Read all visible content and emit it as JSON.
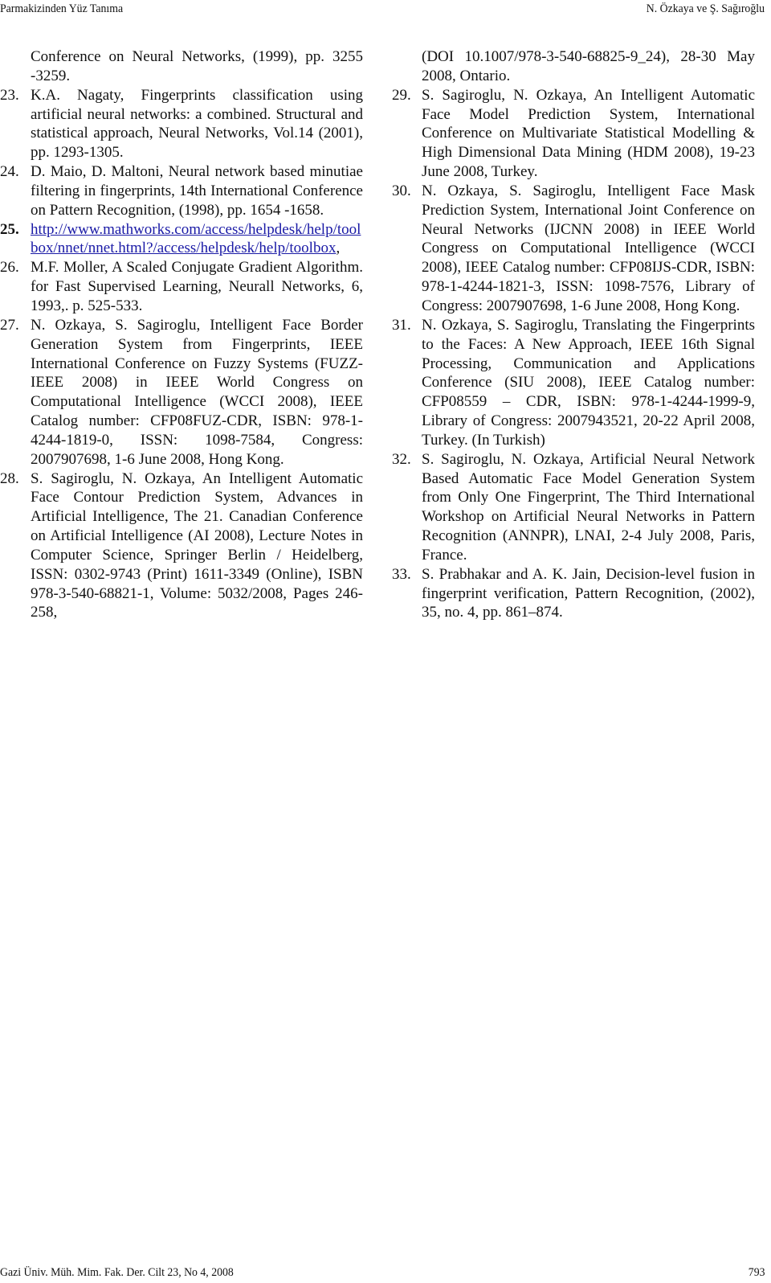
{
  "header": {
    "left": "Parmakizinden Yüz Tanıma",
    "right": "N. Özkaya ve Ş. Sağıroğlu"
  },
  "left_column": {
    "continuation": "Conference on Neural Networks, (1999), pp. 3255 -3259.",
    "refs": [
      {
        "num": "23.",
        "text": "K.A. Nagaty, Fingerprints classification using artificial neural networks: a combined. Structural and statistical approach, Neural Networks, Vol.14 (2001), pp. 1293-1305."
      },
      {
        "num": "24.",
        "text": "D. Maio, D. Maltoni, Neural network based minutiae filtering in fingerprints, 14th International Conference on Pattern Recognition, (1998), pp. 1654 -1658."
      },
      {
        "num": "25.",
        "link": "http://www.mathworks.com/access/helpdesk/help/toolbox/nnet/nnet.html?/access/helpdesk/help/toolbox",
        "after_link": ","
      },
      {
        "num": "26.",
        "text": "M.F. Moller, A Scaled Conjugate Gradient Algorithm. for Fast Supervised Learning, Neurall Networks, 6, 1993,. p. 525-533."
      },
      {
        "num": "27.",
        "text": "N. Ozkaya, S. Sagiroglu, Intelligent Face Border Generation System from Fingerprints, IEEE International Conference on Fuzzy Systems (FUZZ-IEEE 2008) in IEEE World Congress on Computational Intelligence (WCCI 2008), IEEE Catalog number: CFP08FUZ-CDR, ISBN: 978-1-4244-1819-0, ISSN: 1098-7584, Congress: 2007907698, 1-6 June 2008, Hong Kong."
      },
      {
        "num": "28.",
        "text": "S. Sagiroglu, N. Ozkaya, An Intelligent Automatic Face Contour Prediction System, Advances in Artificial Intelligence, The 21. Canadian Conference on Artificial Intelligence (AI 2008), Lecture Notes in Computer Science, Springer Berlin / Heidelberg, ISSN: 0302-9743 (Print) 1611-3349 (Online), ISBN 978-3-540-68821-1, Volume: 5032/2008, Pages 246-258,"
      }
    ]
  },
  "right_column": {
    "continuation": "(DOI 10.1007/978-3-540-68825-9_24), 28-30 May 2008, Ontario.",
    "refs": [
      {
        "num": "29.",
        "text": "S. Sagiroglu, N. Ozkaya, An Intelligent Automatic Face Model Prediction System, International Conference on Multivariate Statistical Modelling & High Dimensional Data Mining (HDM 2008), 19-23 June 2008, Turkey."
      },
      {
        "num": "30.",
        "text": "N. Ozkaya, S. Sagiroglu, Intelligent Face Mask Prediction System, International Joint Conference on Neural Networks (IJCNN 2008) in IEEE World Congress on Computational Intelligence (WCCI 2008), IEEE Catalog number: CFP08IJS-CDR, ISBN: 978-1-4244-1821-3, ISSN: 1098-7576, Library of Congress: 2007907698, 1-6 June 2008, Hong Kong."
      },
      {
        "num": "31.",
        "text": "N. Ozkaya, S. Sagiroglu, Translating the Fingerprints to the Faces: A New Approach, IEEE 16th Signal Processing, Communication and Applications Conference (SIU 2008), IEEE Catalog number: CFP08559 – CDR, ISBN: 978-1-4244-1999-9, Library of Congress: 2007943521, 20-22 April 2008, Turkey. (In Turkish)"
      },
      {
        "num": "32.",
        "text": "S. Sagiroglu, N. Ozkaya, Artificial Neural Network Based Automatic Face Model Generation System from Only One Fingerprint, The Third International Workshop on Artificial Neural Networks in Pattern Recognition (ANNPR), LNAI, 2-4 July 2008, Paris, France."
      },
      {
        "num": "33.",
        "text": "S. Prabhakar and A. K. Jain, Decision-level fusion in fingerprint verification, Pattern Recognition, (2002), 35, no. 4, pp. 861–874."
      }
    ]
  },
  "footer": {
    "left": "Gazi Üniv. Müh. Mim. Fak. Der. Cilt 23, No 4, 2008",
    "right": "793"
  },
  "colors": {
    "text": "#111111",
    "link": "#1a1aa6",
    "background": "#ffffff"
  }
}
